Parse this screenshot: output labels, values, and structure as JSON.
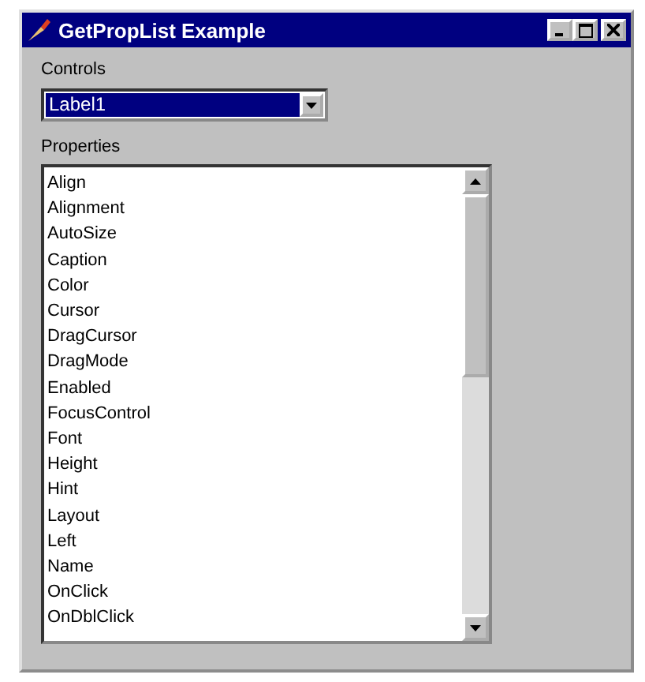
{
  "window": {
    "title": "GetPropList Example"
  },
  "controls": {
    "label": "Controls",
    "value": "Label1",
    "highlighted": true
  },
  "properties": {
    "label": "Properties",
    "items": [
      {
        "text": "Align"
      },
      {
        "text": "Alignment"
      },
      {
        "text": "AutoSize"
      },
      {
        "text": "Caption"
      },
      {
        "text": "Color"
      },
      {
        "text": "Cursor"
      },
      {
        "text": "DragCursor"
      },
      {
        "text": "DragMode"
      },
      {
        "text": "Enabled"
      },
      {
        "text": "FocusControl"
      },
      {
        "text": "Font"
      },
      {
        "text": "Height"
      },
      {
        "text": "Hint"
      },
      {
        "text": "Layout"
      },
      {
        "text": "Left"
      },
      {
        "text": "Name"
      },
      {
        "text": "OnClick"
      },
      {
        "text": "OnDblClick"
      }
    ]
  }
}
